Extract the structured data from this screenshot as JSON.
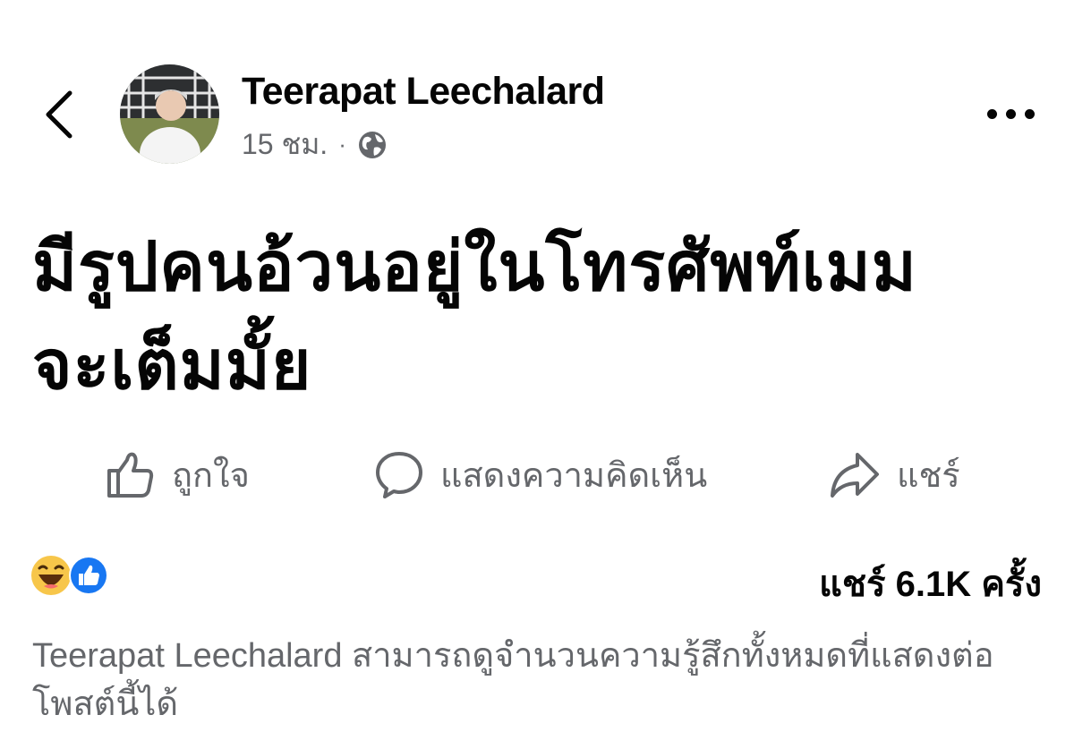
{
  "header": {
    "author_name": "Teerapat Leechalard",
    "timestamp": "15 ชม.",
    "separator": "·",
    "privacy_icon": "globe-icon",
    "back_icon": "chevron-left-icon",
    "more_icon": "more-horizontal-icon"
  },
  "post": {
    "text_line1": "มีรูปคนอ้วนอยู่ในโทรศัพท์เมม",
    "text_line2": "จะเต็มมั้ย"
  },
  "actions": {
    "like_label": "ถูกใจ",
    "comment_label": "แสดงความคิดเห็น",
    "share_label": "แชร์"
  },
  "stats": {
    "reactions": [
      "haha-icon",
      "like-icon"
    ],
    "shares_text": "แชร์ 6.1K ครั้ง"
  },
  "footer": {
    "note": "Teerapat Leechalard สามารถดูจำนวนความรู้สึกทั้งหมดที่แสดงต่อโพสต์นี้ได้"
  },
  "colors": {
    "text_primary": "#050505",
    "text_secondary": "#65676b",
    "like_blue": "#1877f2",
    "haha_yellow": "#f7c64a"
  }
}
